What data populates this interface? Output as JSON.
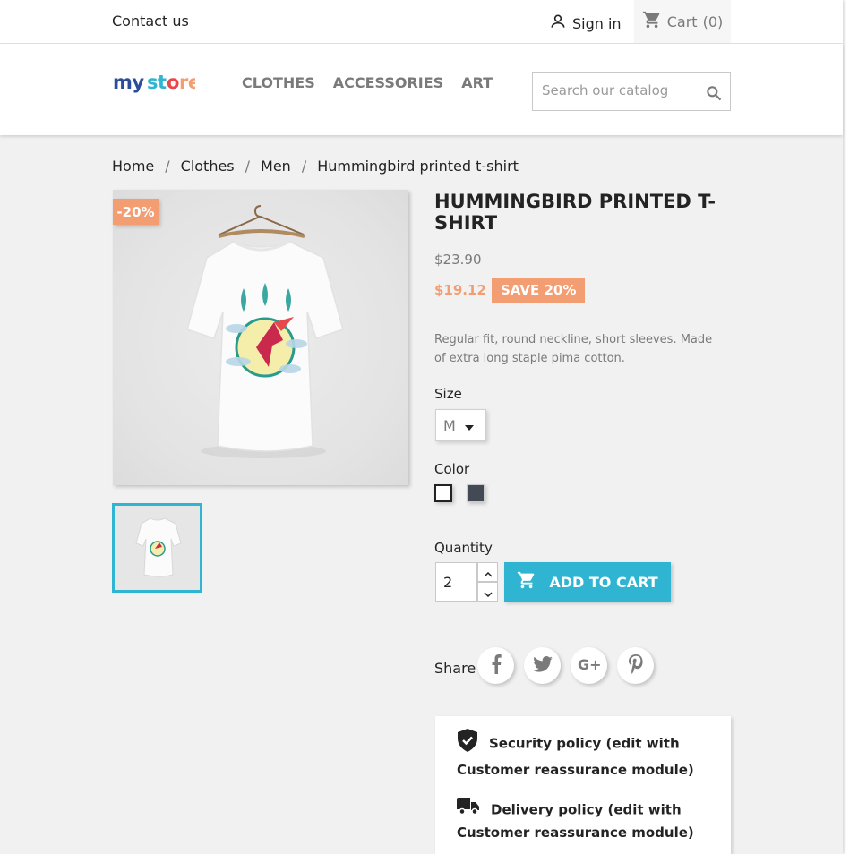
{
  "topnav": {
    "contact": "Contact us",
    "signin": "Sign in",
    "cart": "Cart",
    "cart_count": "(0)"
  },
  "header": {
    "logo_text": "my store",
    "menu": [
      "CLOTHES",
      "ACCESSORIES",
      "ART"
    ],
    "search_placeholder": "Search our catalog"
  },
  "breadcrumb": [
    "Home",
    "Clothes",
    "Men",
    "Hummingbird printed t-shirt"
  ],
  "product": {
    "discount_flag": "-20%",
    "title": "Hummingbird printed t-shirt",
    "old_price": "$23.90",
    "price": "$19.12",
    "save_badge": "SAVE 20%",
    "description": "Regular fit, round neckline, short sleeves. Made of extra long staple pima cotton.",
    "size_label": "Size",
    "size_value": "M",
    "color_label": "Color",
    "colors": [
      "#ffffff",
      "#434a54"
    ],
    "quantity_label": "Quantity",
    "quantity_value": "2",
    "add_to_cart": "Add to cart"
  },
  "share": {
    "label": "Share",
    "buttons": [
      "facebook-icon",
      "twitter-icon",
      "google-plus-icon",
      "pinterest-icon"
    ]
  },
  "reassurance": [
    {
      "icon": "shield-check-icon",
      "text": "Security policy (edit with Customer reassurance module)"
    },
    {
      "icon": "truck-icon",
      "text": "Delivery policy (edit with Customer reassurance module)"
    }
  ],
  "colors": {
    "accent": "#2fb5d2",
    "discount": "#f39d72",
    "text": "#232323",
    "muted": "#7a7a7a",
    "background": "#f1f1f1"
  }
}
